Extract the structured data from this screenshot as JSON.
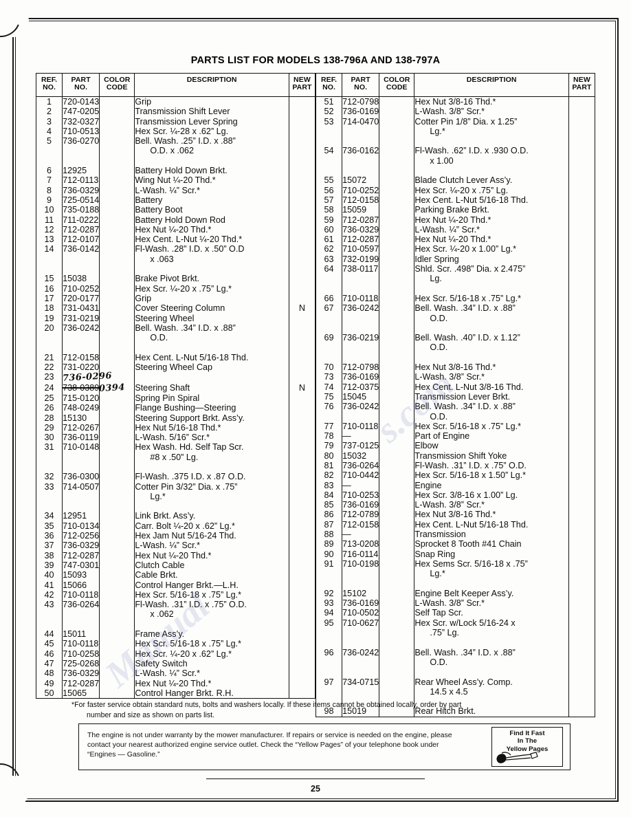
{
  "title": "PARTS LIST FOR MODELS 138-796A AND 138-797A",
  "page_number": "25",
  "headers": {
    "ref_no": "REF.\nNO.",
    "ref_line1": "REF.",
    "ref_line2": "NO.",
    "part_line1": "PART",
    "part_line2": "NO.",
    "color_line1": "COLOR",
    "color_line2": "CODE",
    "description": "DESCRIPTION",
    "new_line1": "NEW",
    "new_line2": "PART"
  },
  "left_table": [
    {
      "ref": "1",
      "part": "720-0143",
      "color": "",
      "desc": "Grip",
      "cont": "",
      "new": ""
    },
    {
      "ref": "2",
      "part": "747-0205",
      "color": "",
      "desc": "Transmission Shift Lever",
      "cont": "",
      "new": ""
    },
    {
      "ref": "3",
      "part": "732-0327",
      "color": "",
      "desc": "Transmission Lever Spring",
      "cont": "",
      "new": ""
    },
    {
      "ref": "4",
      "part": "710-0513",
      "color": "",
      "desc": "Hex Scr. ¼-28 x .62” Lg.",
      "cont": "",
      "new": ""
    },
    {
      "ref": "5",
      "part": "736-0270",
      "color": "",
      "desc": "Bell. Wash. .25” I.D. x .88”",
      "cont": "O.D. x .062",
      "new": ""
    },
    {
      "gap": true
    },
    {
      "ref": "6",
      "part": "12925",
      "color": "",
      "desc": "Battery Hold Down Brkt.",
      "cont": "",
      "new": ""
    },
    {
      "ref": "7",
      "part": "712-0113",
      "color": "",
      "desc": "Wing Nut ¼-20 Thd.*",
      "cont": "",
      "new": ""
    },
    {
      "ref": "8",
      "part": "736-0329",
      "color": "",
      "desc": "L-Wash. ¼” Scr.*",
      "cont": "",
      "new": ""
    },
    {
      "ref": "9",
      "part": "725-0514",
      "color": "",
      "desc": "Battery",
      "cont": "",
      "new": ""
    },
    {
      "ref": "10",
      "part": "735-0188",
      "color": "",
      "desc": "Battery Boot",
      "cont": "",
      "new": ""
    },
    {
      "ref": "11",
      "part": "711-0222",
      "color": "",
      "desc": "Battery Hold Down Rod",
      "cont": "",
      "new": ""
    },
    {
      "ref": "12",
      "part": "712-0287",
      "color": "",
      "desc": "Hex Nut ¼-20 Thd.*",
      "cont": "",
      "new": ""
    },
    {
      "ref": "13",
      "part": "712-0107",
      "color": "",
      "desc": "Hex Cent. L-Nut ¼-20 Thd.*",
      "cont": "",
      "new": ""
    },
    {
      "ref": "14",
      "part": "736-0142",
      "color": "",
      "desc": "Fl-Wash. .28” I.D. x .50” O.D",
      "cont": "x .063",
      "new": ""
    },
    {
      "gap": true
    },
    {
      "ref": "15",
      "part": "15038",
      "color": "",
      "desc": "Brake Pivot Brkt.",
      "cont": "",
      "new": ""
    },
    {
      "ref": "16",
      "part": "710-0252",
      "color": "",
      "desc": "Hex Scr. ¼-20 x .75” Lg.*",
      "cont": "",
      "new": ""
    },
    {
      "ref": "17",
      "part": "720-0177",
      "color": "",
      "desc": "Grip",
      "cont": "",
      "new": ""
    },
    {
      "ref": "18",
      "part": "731-0431",
      "color": "",
      "desc": "Cover Steering Column",
      "cont": "",
      "new": "N"
    },
    {
      "ref": "19",
      "part": "731-0219",
      "color": "",
      "desc": "Steering Wheel",
      "cont": "",
      "new": ""
    },
    {
      "ref": "20",
      "part": "736-0242",
      "color": "",
      "desc": "Bell. Wash. .34” I.D. x .88”",
      "cont": "O.D.",
      "new": ""
    },
    {
      "gap": true
    },
    {
      "ref": "21",
      "part": "712-0158",
      "color": "",
      "desc": "Hex Cent. L-Nut 5/16-18 Thd.",
      "cont": "",
      "new": ""
    },
    {
      "ref": "22",
      "part": "731-0220",
      "color": "",
      "desc": "Steering Wheel Cap",
      "cont": "",
      "new": ""
    },
    {
      "ref": "23",
      "part": "736-0296",
      "color": "",
      "desc": "",
      "cont": "",
      "new": "",
      "handwritten_part": "736-0296"
    },
    {
      "ref": "24",
      "part": "738-0389",
      "color": "",
      "desc": "Steering Shaft",
      "cont": "",
      "new": "N",
      "struck_part": "738-0389",
      "handwritten_correction": "0394"
    },
    {
      "ref": "25",
      "part": "715-0120",
      "color": "",
      "desc": "Spring Pin Spiral",
      "cont": "",
      "new": ""
    },
    {
      "ref": "26",
      "part": "748-0249",
      "color": "",
      "desc": "Flange Bushing—Steering",
      "cont": "",
      "new": ""
    },
    {
      "ref": "28",
      "part": "15130",
      "color": "",
      "desc": "Steering Support Brkt. Ass’y.",
      "cont": "",
      "new": ""
    },
    {
      "ref": "29",
      "part": "712-0267",
      "color": "",
      "desc": "Hex Nut 5/16-18 Thd.*",
      "cont": "",
      "new": ""
    },
    {
      "ref": "30",
      "part": "736-0119",
      "color": "",
      "desc": "L-Wash. 5/16” Scr.*",
      "cont": "",
      "new": ""
    },
    {
      "ref": "31",
      "part": "710-0148",
      "color": "",
      "desc": "Hex Wash. Hd. Self Tap Scr.",
      "cont": "#8 x .50” Lg.",
      "new": ""
    },
    {
      "gap": true
    },
    {
      "ref": "32",
      "part": "736-0300",
      "color": "",
      "desc": "Fl-Wash. .375 I.D. x .87 O.D.",
      "cont": "",
      "new": ""
    },
    {
      "ref": "33",
      "part": "714-0507",
      "color": "",
      "desc": "Cotter Pin 3/32” Dia. x .75”",
      "cont": "Lg.*",
      "new": ""
    },
    {
      "gap": true
    },
    {
      "ref": "34",
      "part": "12951",
      "color": "",
      "desc": "Link Brkt. Ass’y.",
      "cont": "",
      "new": ""
    },
    {
      "ref": "35",
      "part": "710-0134",
      "color": "",
      "desc": "Carr. Bolt ¼-20 x .62” Lg.*",
      "cont": "",
      "new": ""
    },
    {
      "ref": "36",
      "part": "712-0256",
      "color": "",
      "desc": "Hex Jam Nut 5/16-24 Thd.",
      "cont": "",
      "new": ""
    },
    {
      "ref": "37",
      "part": "736-0329",
      "color": "",
      "desc": "L-Wash. ¼” Scr.*",
      "cont": "",
      "new": ""
    },
    {
      "ref": "38",
      "part": "712-0287",
      "color": "",
      "desc": "Hex Nut ¼-20 Thd.*",
      "cont": "",
      "new": ""
    },
    {
      "ref": "39",
      "part": "747-0301",
      "color": "",
      "desc": "Clutch Cable",
      "cont": "",
      "new": ""
    },
    {
      "ref": "40",
      "part": "15093",
      "color": "",
      "desc": "Cable Brkt.",
      "cont": "",
      "new": ""
    },
    {
      "ref": "41",
      "part": "15066",
      "color": "",
      "desc": "Control Hanger Brkt.—L.H.",
      "cont": "",
      "new": ""
    },
    {
      "ref": "42",
      "part": "710-0118",
      "color": "",
      "desc": "Hex Scr. 5/16-18 x .75” Lg.*",
      "cont": "",
      "new": ""
    },
    {
      "ref": "43",
      "part": "736-0264",
      "color": "",
      "desc": "Fl-Wash. .31” I.D. x .75” O.D.",
      "cont": "x .062",
      "new": ""
    },
    {
      "gap": true
    },
    {
      "ref": "44",
      "part": "15011",
      "color": "",
      "desc": "Frame Ass’y.",
      "cont": "",
      "new": ""
    },
    {
      "ref": "45",
      "part": "710-0118",
      "color": "",
      "desc": "Hex Scr. 5/16-18 x .75” Lg.*",
      "cont": "",
      "new": ""
    },
    {
      "ref": "46",
      "part": "710-0258",
      "color": "",
      "desc": "Hex Scr. ¼-20 x .62” Lg.*",
      "cont": "",
      "new": ""
    },
    {
      "ref": "47",
      "part": "725-0268",
      "color": "",
      "desc": "Safety Switch",
      "cont": "",
      "new": ""
    },
    {
      "ref": "48",
      "part": "736-0329",
      "color": "",
      "desc": "L-Wash. ¼” Scr.*",
      "cont": "",
      "new": ""
    },
    {
      "ref": "49",
      "part": "712-0287",
      "color": "",
      "desc": "Hex Nut ¼-20 Thd.*",
      "cont": "",
      "new": ""
    },
    {
      "ref": "50",
      "part": "15065",
      "color": "",
      "desc": "Control Hanger Brkt. R.H.",
      "cont": "",
      "new": ""
    }
  ],
  "right_table": [
    {
      "ref": "51",
      "part": "712-0798",
      "color": "",
      "desc": "Hex Nut 3/8-16 Thd.*",
      "cont": "",
      "new": ""
    },
    {
      "ref": "52",
      "part": "736-0169",
      "color": "",
      "desc": "L-Wash. 3/8” Scr.*",
      "cont": "",
      "new": ""
    },
    {
      "ref": "53",
      "part": "714-0470",
      "color": "",
      "desc": "Cotter Pin 1/8” Dia. x 1.25”",
      "cont": "Lg.*",
      "new": ""
    },
    {
      "gap": true
    },
    {
      "ref": "54",
      "part": "736-0162",
      "color": "",
      "desc": "Fl-Wash. .62” I.D. x .930 O.D.",
      "cont": "x 1.00",
      "new": ""
    },
    {
      "gap": true
    },
    {
      "ref": "55",
      "part": "15072",
      "color": "",
      "desc": "Blade Clutch Lever Ass’y.",
      "cont": "",
      "new": ""
    },
    {
      "ref": "56",
      "part": "710-0252",
      "color": "",
      "desc": "Hex Scr. ¼-20 x .75” Lg.",
      "cont": "",
      "new": ""
    },
    {
      "ref": "57",
      "part": "712-0158",
      "color": "",
      "desc": "Hex Cent. L-Nut 5/16-18 Thd.",
      "cont": "",
      "new": ""
    },
    {
      "ref": "58",
      "part": "15059",
      "color": "",
      "desc": "Parking Brake Brkt.",
      "cont": "",
      "new": ""
    },
    {
      "ref": "59",
      "part": "712-0287",
      "color": "",
      "desc": "Hex Nut ¼-20 Thd.*",
      "cont": "",
      "new": ""
    },
    {
      "ref": "60",
      "part": "736-0329",
      "color": "",
      "desc": "L-Wash. ¼” Scr.*",
      "cont": "",
      "new": ""
    },
    {
      "ref": "61",
      "part": "712-0287",
      "color": "",
      "desc": "Hex Nut ¼-20 Thd.*",
      "cont": "",
      "new": ""
    },
    {
      "ref": "62",
      "part": "710-0597",
      "color": "",
      "desc": "Hex Scr. ¼-20 x 1.00” Lg.*",
      "cont": "",
      "new": ""
    },
    {
      "ref": "63",
      "part": "732-0199",
      "color": "",
      "desc": "Idler Spring",
      "cont": "",
      "new": ""
    },
    {
      "ref": "64",
      "part": "738-0117",
      "color": "",
      "desc": "Shld. Scr. .498” Dia. x 2.475”",
      "cont": "Lg.",
      "new": ""
    },
    {
      "gap": true
    },
    {
      "ref": "66",
      "part": "710-0118",
      "color": "",
      "desc": "Hex Scr. 5/16-18 x .75” Lg.*",
      "cont": "",
      "new": ""
    },
    {
      "ref": "67",
      "part": "736-0242",
      "color": "",
      "desc": "Bell. Wash. .34” I.D. x  .88”",
      "cont": "O.D.",
      "new": ""
    },
    {
      "gap": true
    },
    {
      "ref": "69",
      "part": "736-0219",
      "color": "",
      "desc": "Bell. Wash. .40” I.D. x 1.12”",
      "cont": "O.D.",
      "new": ""
    },
    {
      "gap": true
    },
    {
      "ref": "70",
      "part": "712-0798",
      "color": "",
      "desc": "Hex Nut 3/8-16 Thd.*",
      "cont": "",
      "new": ""
    },
    {
      "ref": "73",
      "part": "736-0169",
      "color": "",
      "desc": "L-Wash. 3/8” Scr.*",
      "cont": "",
      "new": ""
    },
    {
      "ref": "74",
      "part": "712-0375",
      "color": "",
      "desc": "Hex Cent. L-Nut 3/8-16 Thd.",
      "cont": "",
      "new": ""
    },
    {
      "ref": "75",
      "part": "15045",
      "color": "",
      "desc": "Transmission Lever Brkt.",
      "cont": "",
      "new": ""
    },
    {
      "ref": "76",
      "part": "736-0242",
      "color": "",
      "desc": "Bell. Wash. .34” I.D. x .88”",
      "cont": "O.D.",
      "new": ""
    },
    {
      "ref": "77",
      "part": "710-0118",
      "color": "",
      "desc": "Hex Scr. 5/16-18 x .75” Lg.*",
      "cont": "",
      "new": ""
    },
    {
      "ref": "78",
      "part": "—",
      "color": "",
      "desc": "Part of Engine",
      "cont": "",
      "new": ""
    },
    {
      "ref": "79",
      "part": "737-0125",
      "color": "",
      "desc": "Elbow",
      "cont": "",
      "new": ""
    },
    {
      "ref": "80",
      "part": "15032",
      "color": "",
      "desc": "Transmission Shift Yoke",
      "cont": "",
      "new": ""
    },
    {
      "ref": "81",
      "part": "736-0264",
      "color": "",
      "desc": "Fl-Wash. .31” I.D. x .75” O.D.",
      "cont": "",
      "new": ""
    },
    {
      "ref": "82",
      "part": "710-0442",
      "color": "",
      "desc": "Hex Scr. 5/16-18 x 1.50” Lg.*",
      "cont": "",
      "new": ""
    },
    {
      "ref": "83",
      "part": "—",
      "color": "",
      "desc": "Engine",
      "cont": "",
      "new": ""
    },
    {
      "ref": "84",
      "part": "710-0253",
      "color": "",
      "desc": "Hex Scr. 3/8-16 x 1.00” Lg.",
      "cont": "",
      "new": ""
    },
    {
      "ref": "85",
      "part": "736-0169",
      "color": "",
      "desc": "L-Wash. 3/8” Scr.*",
      "cont": "",
      "new": ""
    },
    {
      "ref": "86",
      "part": "712-0789",
      "color": "",
      "desc": "Hex Nut 3/8-16 Thd.*",
      "cont": "",
      "new": ""
    },
    {
      "ref": "87",
      "part": "712-0158",
      "color": "",
      "desc": "Hex Cent. L-Nut 5/16-18 Thd.",
      "cont": "",
      "new": ""
    },
    {
      "ref": "88",
      "part": "—",
      "color": "",
      "desc": "Transmission",
      "cont": "",
      "new": ""
    },
    {
      "ref": "89",
      "part": "713-0208",
      "color": "",
      "desc": "Sprocket 8 Tooth #41 Chain",
      "cont": "",
      "new": ""
    },
    {
      "ref": "90",
      "part": "716-0114",
      "color": "",
      "desc": "Snap Ring",
      "cont": "",
      "new": ""
    },
    {
      "ref": "91",
      "part": "710-0198",
      "color": "",
      "desc": "Hex Sems Scr. 5/16-18 x .75”",
      "cont": "Lg.*",
      "new": ""
    },
    {
      "gap": true
    },
    {
      "ref": "92",
      "part": "15102",
      "color": "",
      "desc": "Engine Belt Keeper Ass’y.",
      "cont": "",
      "new": ""
    },
    {
      "ref": "93",
      "part": "736-0169",
      "color": "",
      "desc": "L-Wash. 3/8” Scr.*",
      "cont": "",
      "new": ""
    },
    {
      "ref": "94",
      "part": "710-0502",
      "color": "",
      "desc": "Self Tap Scr.",
      "cont": "",
      "new": ""
    },
    {
      "ref": "95",
      "part": "710-0627",
      "color": "",
      "desc": "Hex Scr. w/Lock 5/16-24 x",
      "cont": ".75” Lg.",
      "new": ""
    },
    {
      "gap": true
    },
    {
      "ref": "96",
      "part": "736-0242",
      "color": "",
      "desc": "Bell. Wash. .34” I.D. x .88”",
      "cont": "O.D.",
      "new": ""
    },
    {
      "gap": true
    },
    {
      "ref": "97",
      "part": "734-0715",
      "color": "",
      "desc": "Rear Wheel Ass’y. Comp.",
      "cont": "14.5 x 4.5",
      "new": ""
    },
    {
      "gap": true
    },
    {
      "ref": "98",
      "part": "15019",
      "color": "",
      "desc": "Rear Hitch Brkt.",
      "cont": "",
      "new": ""
    }
  ],
  "footnote": {
    "line1": "*For faster service obtain standard nuts, bolts and washers locally. If these items cannot be obtained locally, order by part",
    "line2": "number and size as shown on parts list."
  },
  "warranty": {
    "text": "The engine is not under warranty by the mower manufacturer. If repairs or service is needed on the engine, please contact your nearest authorized engine service outlet. Check the “Yellow Pages” of your telephone book under “Engines — Gasoline.”"
  },
  "yellow_pages_badge": {
    "line1": "Find It Fast",
    "line2": "In The",
    "line3": "Yellow Pages"
  },
  "watermark": {
    "text1": "Manual",
    "text2": "s.com"
  }
}
